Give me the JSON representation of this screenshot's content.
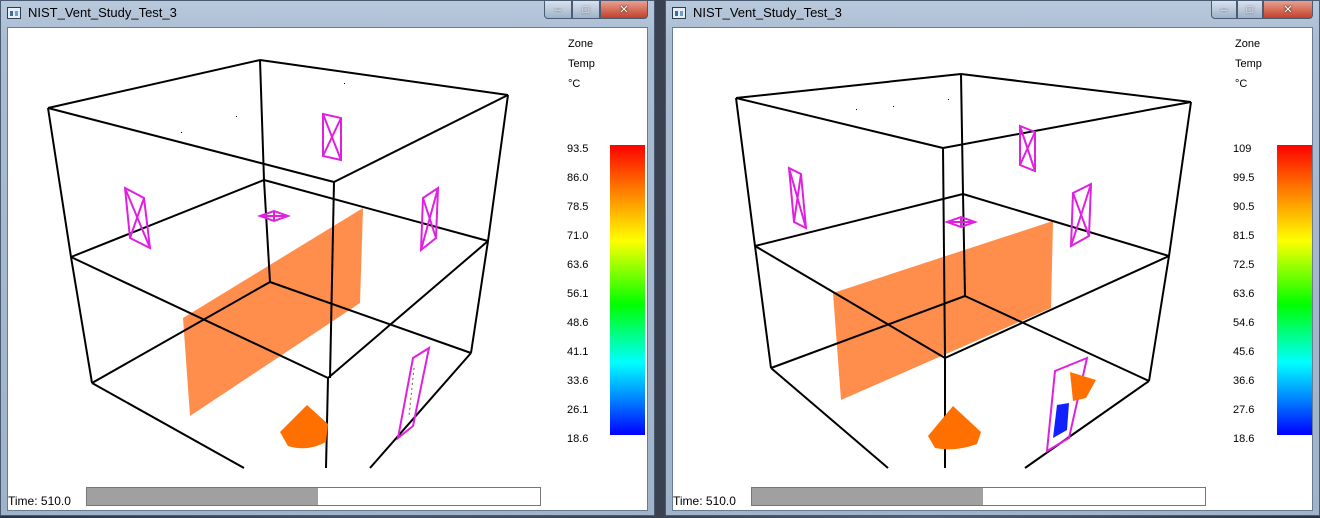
{
  "windows": [
    {
      "title": "NIST_Vent_Study_Test_3",
      "legend": {
        "header": [
          "Zone",
          "Temp",
          "°C"
        ],
        "ticks": [
          "93.5",
          "86.0",
          "78.5",
          "71.0",
          "63.6",
          "56.1",
          "48.6",
          "41.1",
          "33.6",
          "26.1",
          "18.6"
        ]
      },
      "time_label": "Time: 510.0",
      "progress": 0.51
    },
    {
      "title": "NIST_Vent_Study_Test_3",
      "legend": {
        "header": [
          "Zone",
          "Temp",
          "°C"
        ],
        "ticks": [
          "109",
          "99.5",
          "90.5",
          "81.5",
          "72.5",
          "63.6",
          "54.6",
          "45.6",
          "36.6",
          "27.6",
          "18.6"
        ]
      },
      "time_label": "Time: 510.0",
      "progress": 0.51
    }
  ],
  "window_buttons": {
    "minimize": "–",
    "maximize": "□",
    "close": "✕"
  },
  "colors": {
    "wall": "#ff6a1a",
    "fire": "#ff7000",
    "vent": "#e020e0",
    "cold_vent": "#1020ff",
    "edges": "#000000"
  }
}
